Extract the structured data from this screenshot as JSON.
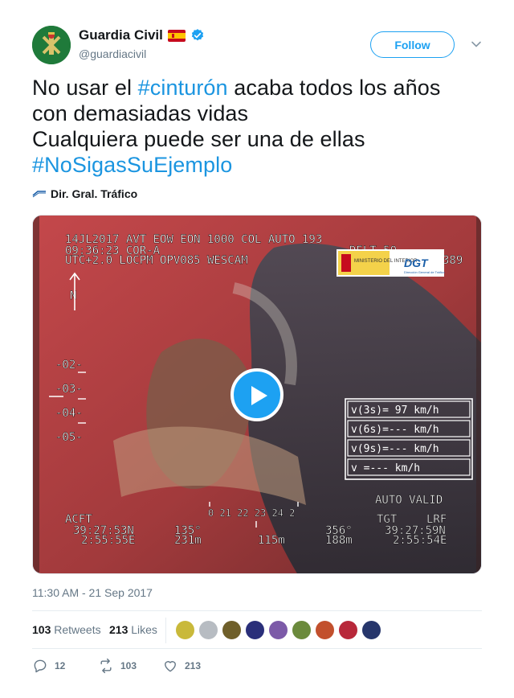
{
  "author": {
    "display_name": "Guardia Civil",
    "handle": "@guardiacivil",
    "verified": true,
    "flag": "Spain"
  },
  "follow_button": {
    "label": "Follow"
  },
  "tweet": {
    "line1_before": "No usar el ",
    "line1_hashtag": "#cinturón",
    "line1_after": " acaba todos los años",
    "line2": "con demasiadas vidas",
    "line3": "Cualquiera puede ser una de ellas",
    "line4_hashtag": "#NoSigasSuEjemplo"
  },
  "source": {
    "label": "Dir. Gral. Tráfico"
  },
  "video": {
    "osd": {
      "row1": "14JL2017  AVT   EOW    EON  1000  COL   AUTO    193",
      "row2a": "09:36:23    COR-A",
      "row2b": "DELT  50",
      "row3": "UTC+2.0   LOCPM   OPV085   WESCAM",
      "row3_right": "389",
      "north": "N",
      "scale": [
        "-02-",
        "-03-",
        "-04-",
        "-05-"
      ],
      "speed_rows": [
        "v(3s)= 97 km/h",
        "v(6s)=--- km/h",
        "v(9s)=--- km/h",
        "v   =--- km/h"
      ],
      "auto_valid": "AUTO VALID",
      "acft_label": "ACFT",
      "acft_lat": "39:27:53N",
      "acft_lon": "2:55:55E",
      "heading": "135°",
      "range1": "231m",
      "range_center": "115m",
      "bearing": "356°",
      "range2": "188m",
      "tgt_label": "TGT",
      "lrf_label": "LRF",
      "tgt_lat": "39:27:59N",
      "tgt_lon": "2:55:54E",
      "heading_scale": "0 21 22 23 24 2",
      "logo_ministerio": "MINISTERIO DEL INTERIOR",
      "logo_dgt": "DGT",
      "logo_dgt_sub": "Dirección General de Tráfico"
    }
  },
  "timestamp": "11:30 AM - 21 Sep 2017",
  "stats": {
    "retweets_count": "103",
    "retweets_label": "Retweets",
    "likes_count": "213",
    "likes_label": "Likes"
  },
  "actions": {
    "replies": "12",
    "retweets": "103",
    "likes": "213"
  },
  "colors": {
    "accent": "#1da1f2",
    "hashtag": "#1b95e0",
    "muted": "#657786",
    "text": "#14171a"
  }
}
